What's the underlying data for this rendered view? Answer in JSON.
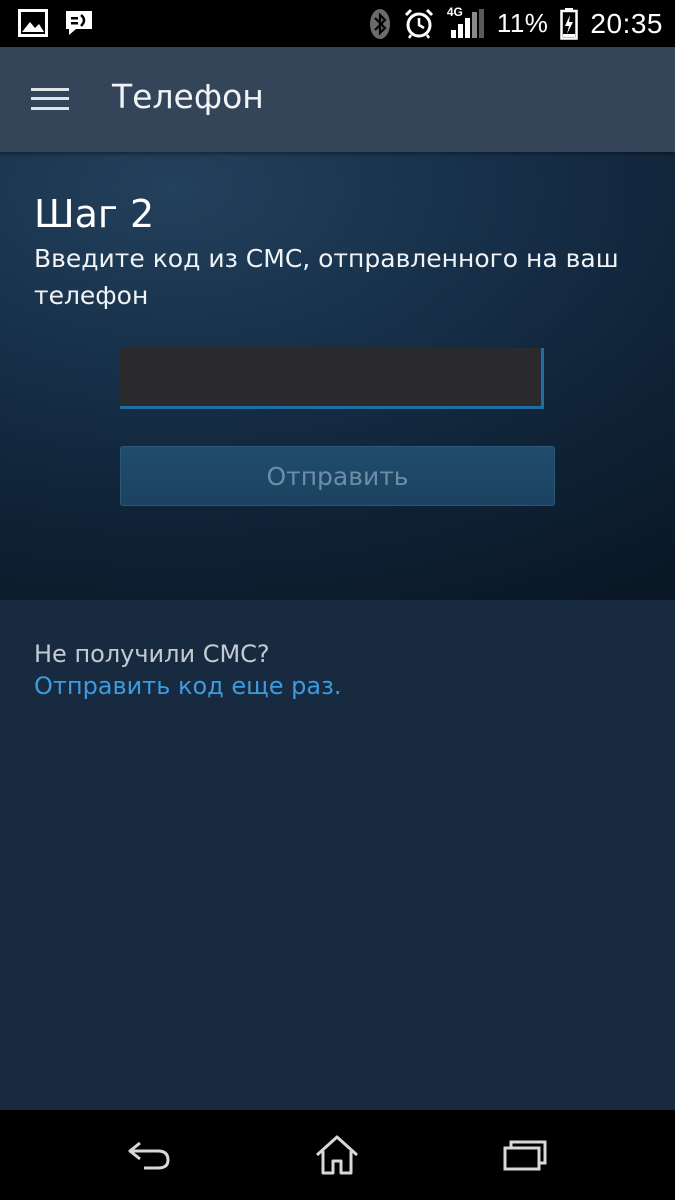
{
  "status_bar": {
    "left_icons": [
      "gallery-icon",
      "message-icon"
    ],
    "network": "4G",
    "battery_percent": "11%",
    "time": "20:35",
    "icons": [
      "bluetooth-icon",
      "alarm-icon",
      "signal-icon",
      "battery-charging-icon"
    ]
  },
  "app_bar": {
    "menu_icon": "hamburger-menu-icon",
    "title": "Телефон"
  },
  "step": {
    "title": "Шаг 2",
    "description": "Введите код из СМС, отправленного на ваш телефон",
    "code_value": "",
    "code_placeholder": "",
    "submit_label": "Отправить"
  },
  "help": {
    "question": "Не получили СМС?",
    "resend_link": "Отправить код еще раз."
  },
  "nav_bar": {
    "buttons": [
      "back-icon",
      "home-icon",
      "recent-apps-icon"
    ]
  },
  "colors": {
    "app_bar_bg": "#344459",
    "page_bg": "#182a3f",
    "link": "#3c9be0",
    "input_accent": "#1b6ea6"
  }
}
